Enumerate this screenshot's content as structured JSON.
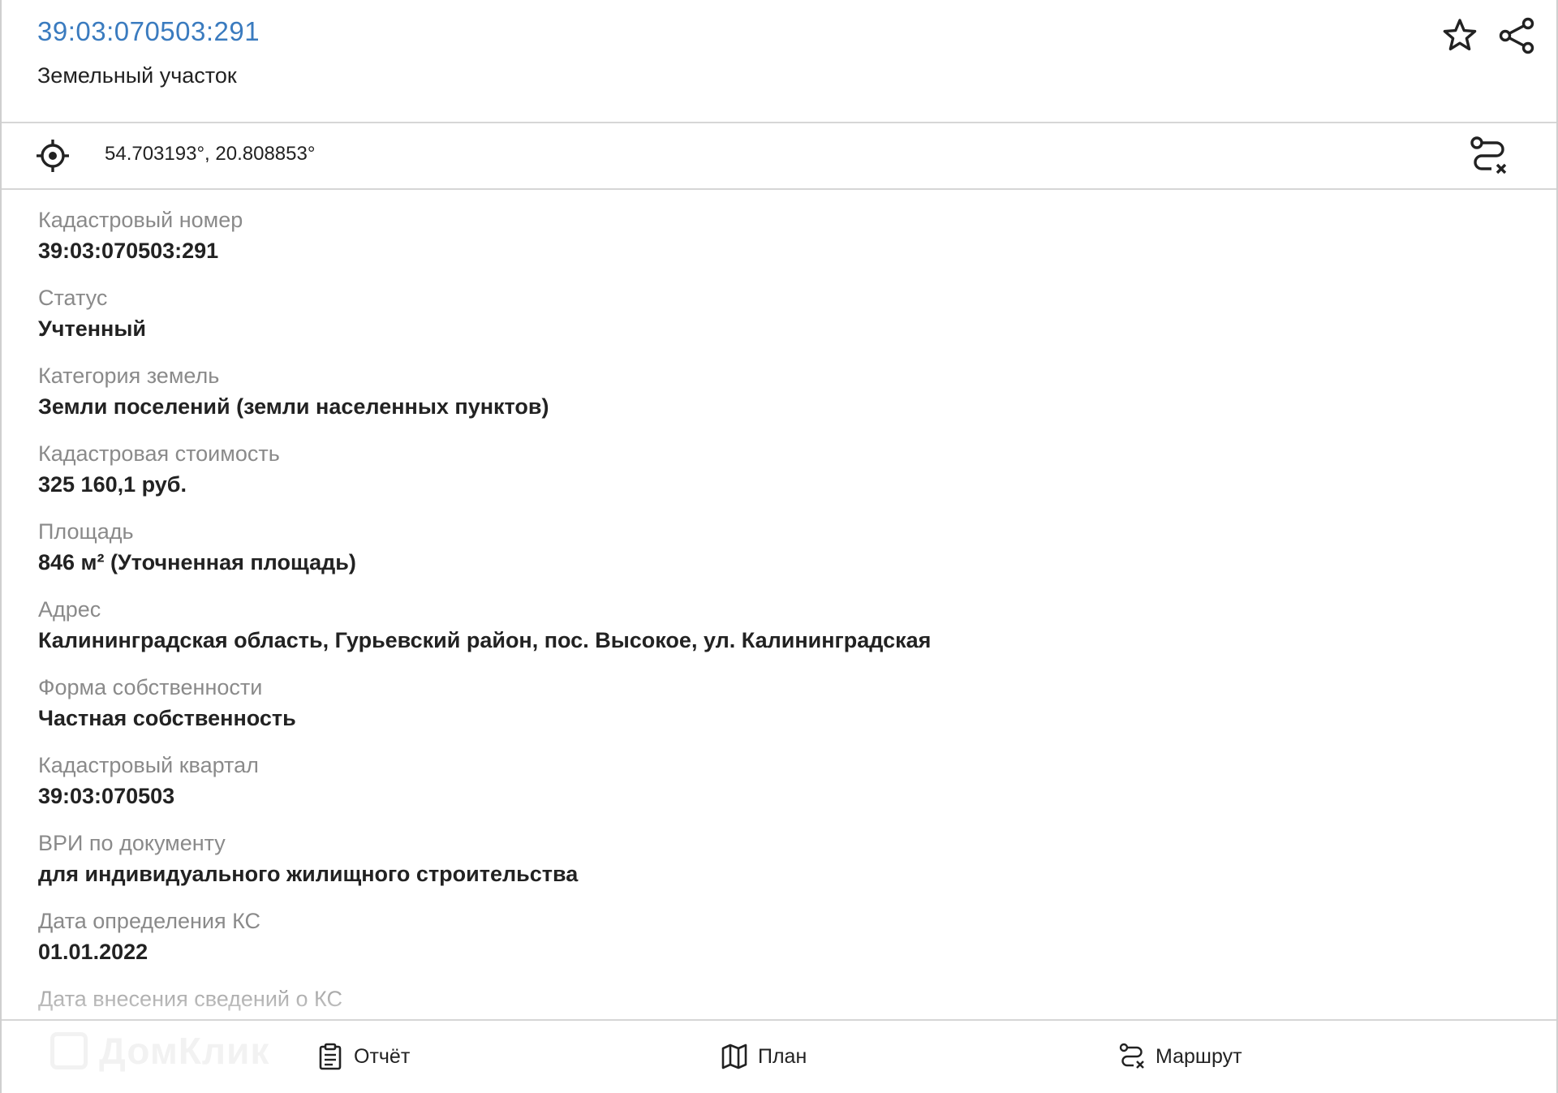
{
  "header": {
    "title": "39:03:070503:291",
    "subtitle": "Земельный участок",
    "star_icon": "star-icon",
    "share_icon": "share-icon"
  },
  "coords": {
    "text": "54.703193°, 20.808853°",
    "target_icon": "target-icon",
    "route_icon": "route-icon"
  },
  "info": [
    {
      "label": "Кадастровый номер",
      "value": "39:03:070503:291"
    },
    {
      "label": "Статус",
      "value": "Учтенный"
    },
    {
      "label": "Категория земель",
      "value": "Земли поселений (земли населенных пунктов)"
    },
    {
      "label": "Кадастровая стоимость",
      "value": "325 160,1 руб."
    },
    {
      "label": "Площадь",
      "value": "846 м² (Уточненная площадь)"
    },
    {
      "label": "Адрес",
      "value": "Калининградская область, Гурьевский район, пос. Высокое, ул. Калининградская"
    },
    {
      "label": "Форма собственности",
      "value": "Частная собственность"
    },
    {
      "label": "Кадастровый квартал",
      "value": "39:03:070503"
    },
    {
      "label": "ВРИ по документу",
      "value": "для индивидуального жилищного строительства"
    },
    {
      "label": "Дата определения КС",
      "value": "01.01.2022"
    },
    {
      "label": "Дата внесения сведений о КС",
      "value": ""
    }
  ],
  "toolbar": {
    "report_label": "Отчёт",
    "plan_label": "План",
    "route_label": "Маршрут",
    "watermark": "ДомКлик"
  }
}
